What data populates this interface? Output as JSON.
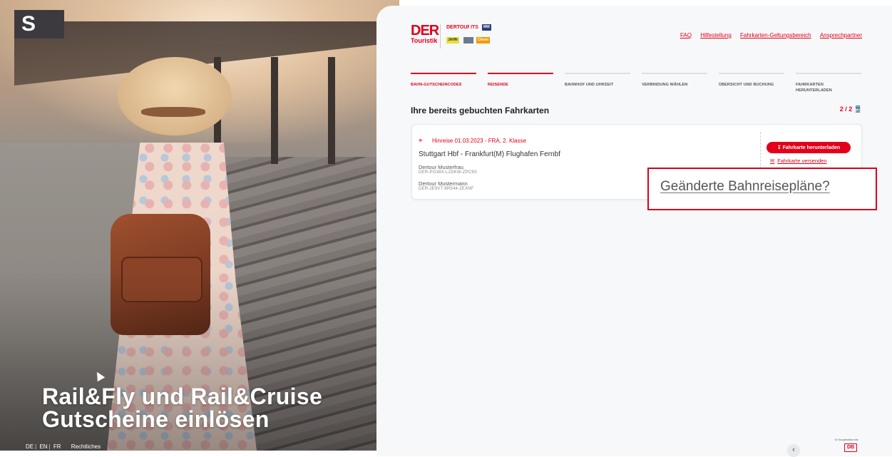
{
  "hero": {
    "title_line1": "Rail&Fly und Rail&Cruise",
    "title_line2": "Gutscheine einlösen",
    "sign": "S",
    "languages": [
      "DE",
      "EN",
      "FR"
    ],
    "legal_link": "Rechtliches"
  },
  "brand": {
    "der": "DER",
    "touristik": "Touristik",
    "sub_brands": [
      "DERTOUR",
      "ITS",
      "MEIERS WELTREISEN",
      "JAHN REISEN",
      "Clever REISEN"
    ]
  },
  "topnav": [
    "FAQ",
    "Hilfestellung",
    "Fahrkarten-Geltungsbereich",
    "Ansprechpartner"
  ],
  "steps": [
    {
      "label": "BAHN-GUTSCHEINCODES",
      "active": true
    },
    {
      "label": "REISENDE",
      "active": true
    },
    {
      "label": "BAHNHOF UND UHRZEIT",
      "active": false
    },
    {
      "label": "VERBINDUNG WÄHLEN",
      "active": false
    },
    {
      "label": "ÜBERSICHT UND BUCHUNG",
      "active": false
    },
    {
      "label": "FAHRKARTEN HERUNTERLADEN",
      "active": false
    }
  ],
  "section": {
    "title": "Ihre bereits gebuchten Fahrkarten",
    "counter": "2 / 2"
  },
  "booking": {
    "leg": "Hinreise 01.03.2023 - FRA, 2. Klasse",
    "route": "Stuttgart Hbf - Frankfurt(M) Flughafen Fernbf",
    "passengers": [
      {
        "name": "Dertour Musterfrau",
        "code": "DER-PG38X-L2DKW-ZPC9X"
      },
      {
        "name": "Dertour Mustermann",
        "code": "DER-JE9VT-6R544-2EXNF"
      }
    ],
    "download_label": "Fahrkarte herunterladen",
    "send_label": "Fahrkarte versenden"
  },
  "popup": {
    "text": "Geänderte Bahnreisepläne?"
  },
  "footer": {
    "back": "‹",
    "coop": "In Kooperation mit",
    "db": "DB"
  },
  "colors": {
    "accent": "#e2001a",
    "panel_bg": "#f7f8fa"
  }
}
